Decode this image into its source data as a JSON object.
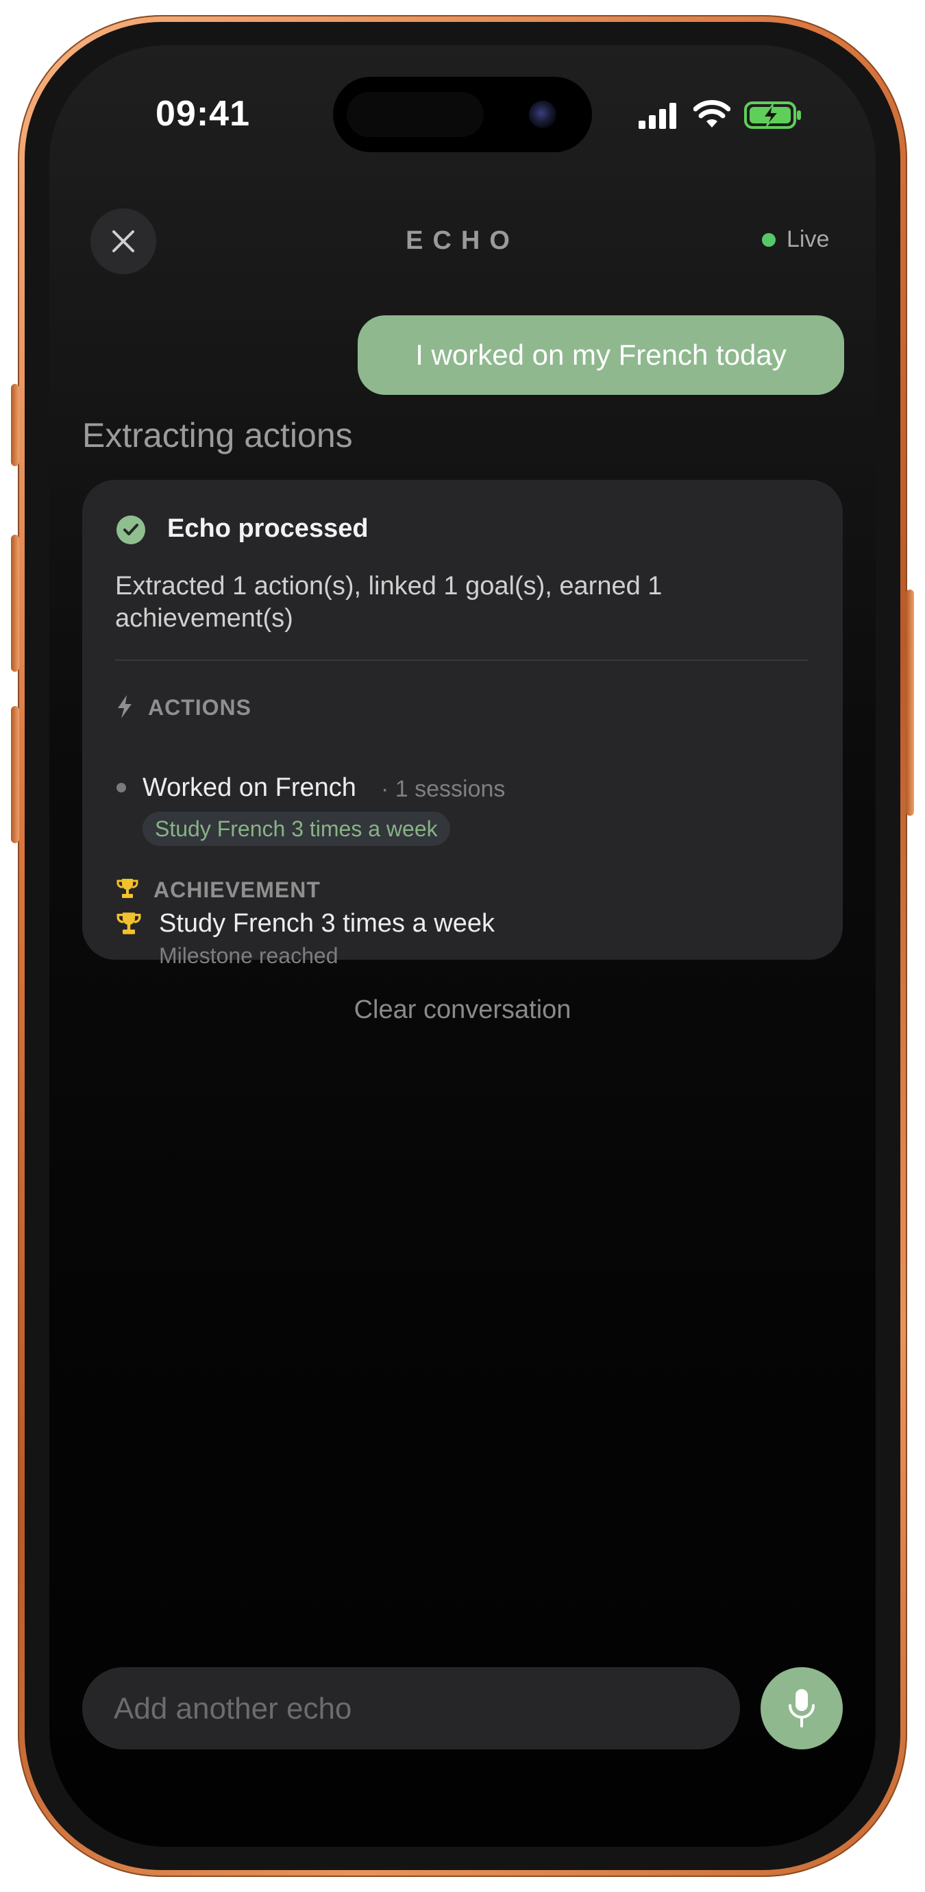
{
  "status_bar": {
    "time": "09:41",
    "icons": [
      "signal-icon",
      "wifi-icon",
      "battery-charging-icon"
    ]
  },
  "header": {
    "title": "ECHO",
    "live_label": "Live",
    "live_color": "#56c86a"
  },
  "conversation": {
    "user_message": "I worked on my French today",
    "status_text": "Extracting actions"
  },
  "result_card": {
    "title": "Echo processed",
    "summary": "Extracted 1 action(s), linked 1 goal(s), earned 1 achievement(s)",
    "actions_section": {
      "label": "ACTIONS",
      "items": [
        {
          "name": "Worked on French",
          "meta": "· 1 sessions",
          "goal": "Study French 3 times a week"
        }
      ]
    },
    "achievement_section": {
      "label": "ACHIEVEMENT",
      "items": [
        {
          "name": "Study French 3 times a week",
          "subtitle": "Milestone reached"
        }
      ]
    }
  },
  "clear_label": "Clear conversation",
  "composer": {
    "placeholder": "Add another echo",
    "value": ""
  },
  "colors": {
    "accent": "#8fb88f",
    "trophy": "#f2c12e",
    "device": "#d9773f"
  }
}
